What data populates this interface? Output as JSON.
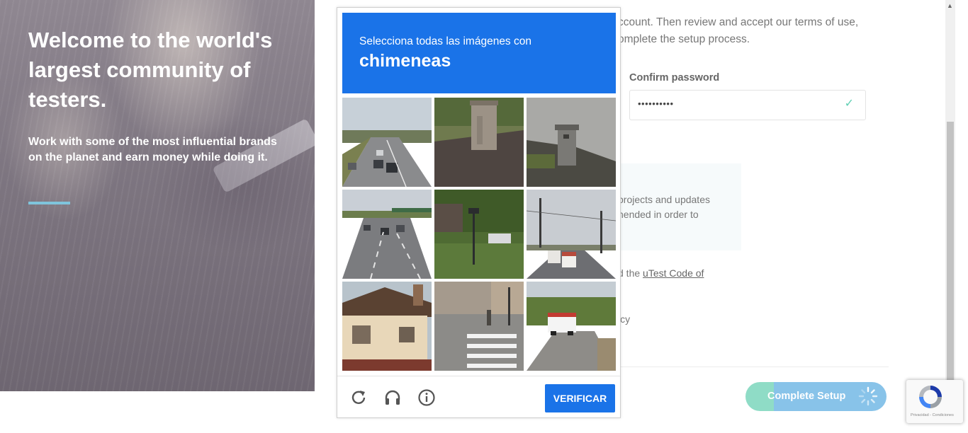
{
  "hero": {
    "title": "Welcome to the world's largest community of testers.",
    "subtitle": "Work with some of the most influential brands on the planet and earn money while doing it."
  },
  "setup_form": {
    "intro_line1": "ccount. Then review and accept our terms of use,",
    "intro_line2": "omplete the setup process.",
    "confirm_password_label": "Confirm password",
    "confirm_password_value": "••••••••••",
    "notice_line1": "projects and updates",
    "notice_line2": "hended in order to",
    "code_prefix": "d the ",
    "code_link": "uTest Code of",
    "policy_fragment": "icy",
    "complete_button_label": "Complete Setup"
  },
  "captcha": {
    "instruction": "Selecciona todas las imágenes con",
    "target": "chimeneas",
    "verify_label": "VERIFICAR",
    "tiles": [
      {
        "scene": "highway"
      },
      {
        "scene": "chimney-rooftop"
      },
      {
        "scene": "chimney-roof-left"
      },
      {
        "scene": "highway-overpass"
      },
      {
        "scene": "park-lamppost"
      },
      {
        "scene": "street-powerlines"
      },
      {
        "scene": "house-roof"
      },
      {
        "scene": "crosswalk"
      },
      {
        "scene": "road-truck"
      }
    ]
  },
  "badge": {
    "legal": "Privacidad - Condiciones"
  },
  "colors": {
    "captcha_blue": "#1a73e8",
    "hero_accent": "#7fc4dc",
    "check_green": "#5fcfb3",
    "button_teal": "#8fdcc6",
    "button_blue": "#88c3e9"
  }
}
